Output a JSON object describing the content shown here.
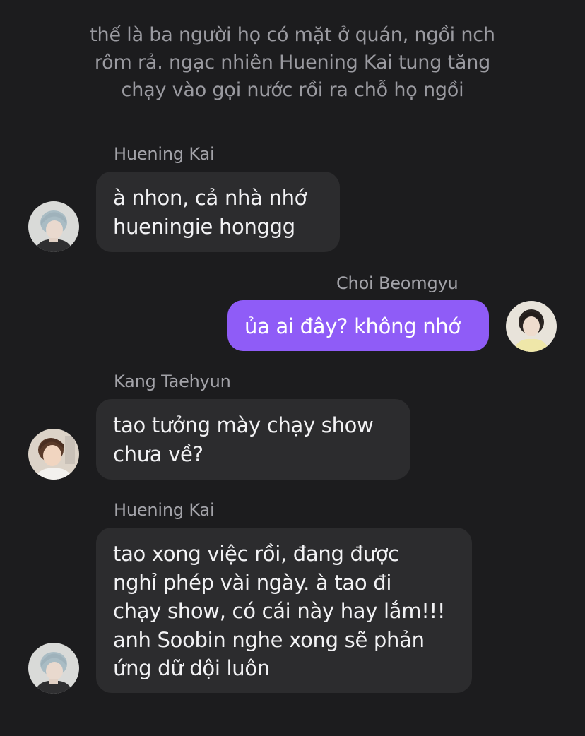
{
  "narration": {
    "lines": [
      "thế là ba người họ có mặt ở quán, ngồi nch",
      "rôm rả. ngạc nhiên Huening Kai tung tăng",
      "chạy vào gọi nước rồi ra chỗ họ ngồi"
    ]
  },
  "messages": [
    {
      "sender": "Huening Kai",
      "direction": "incoming",
      "lines": [
        "à nhon, cả nhà nhớ",
        "hueningie honggg"
      ],
      "avatar_icon": "huening-kai-avatar"
    },
    {
      "sender": "Choi Beomgyu",
      "direction": "outgoing",
      "lines": [
        "ủa ai đây? không nhớ"
      ],
      "avatar_icon": "choi-beomgyu-avatar"
    },
    {
      "sender": "Kang Taehyun",
      "direction": "incoming",
      "lines": [
        "tao tưởng mày chạy show",
        "chưa về?"
      ],
      "avatar_icon": "kang-taehyun-avatar"
    },
    {
      "sender": "Huening Kai",
      "direction": "incoming",
      "lines": [
        "tao xong việc rồi, đang được",
        "nghỉ phép vài ngày. à tao đi",
        "chạy show, có cái này hay lắm!!!",
        "anh Soobin nghe xong sẽ phản",
        "ứng dữ dội luôn"
      ],
      "avatar_icon": "huening-kai-avatar"
    }
  ],
  "colors": {
    "background": "#1c1c1e",
    "incoming_bubble": "#2c2c2e",
    "outgoing_bubble": "#8f5cf7",
    "narration_text": "#9a9aa0",
    "sender_text": "#a3a3a9",
    "message_text": "#f2f2f4"
  }
}
